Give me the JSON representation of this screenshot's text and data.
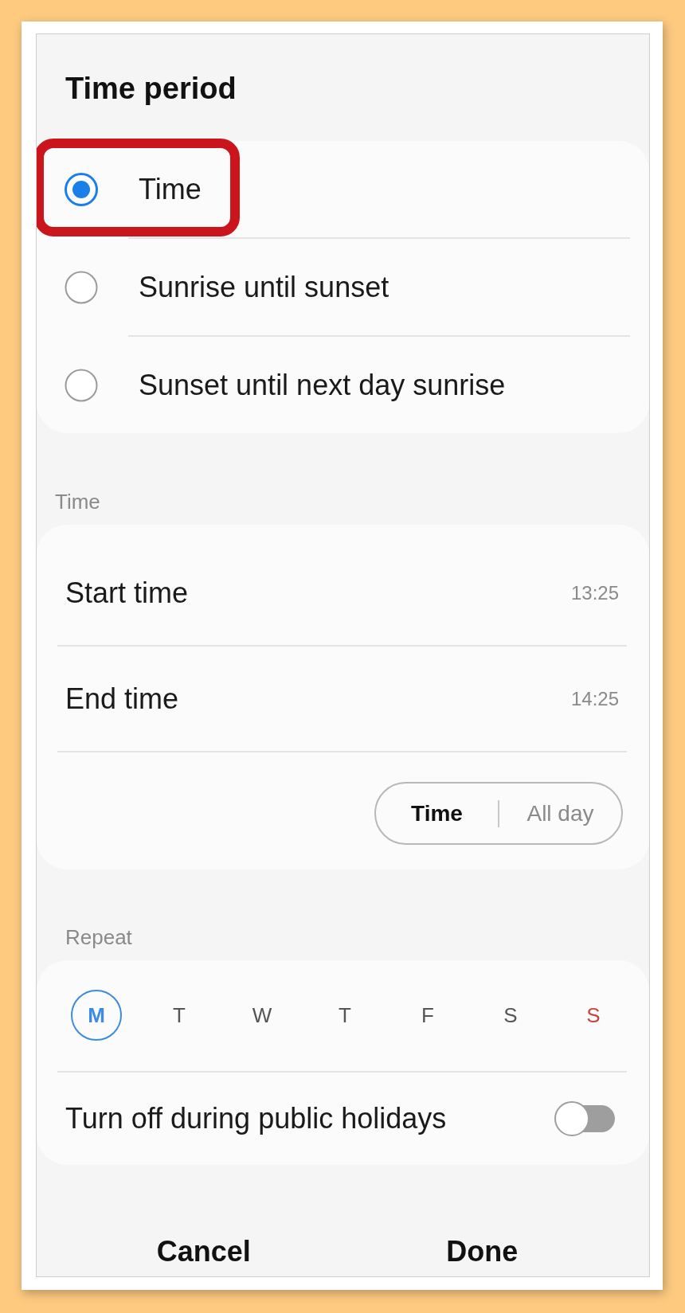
{
  "title": "Time period",
  "time_period": {
    "options": [
      {
        "label": "Time",
        "selected": true,
        "highlighted": true
      },
      {
        "label": "Sunrise until sunset",
        "selected": false,
        "highlighted": false
      },
      {
        "label": "Sunset until next day sunrise",
        "selected": false,
        "highlighted": false
      }
    ]
  },
  "time": {
    "label": "Time",
    "rows": [
      {
        "label": "Start time",
        "value": "13:25"
      },
      {
        "label": "End time",
        "value": "14:25"
      }
    ],
    "modes": [
      {
        "label": "Time",
        "selected": true
      },
      {
        "label": "All day",
        "selected": false
      }
    ]
  },
  "repeat": {
    "label": "Repeat",
    "days": [
      {
        "label": "M",
        "selected": true,
        "color": "#3d8be0"
      },
      {
        "label": "T",
        "selected": false,
        "color": "#555555"
      },
      {
        "label": "W",
        "selected": false,
        "color": "#555555"
      },
      {
        "label": "T",
        "selected": false,
        "color": "#555555"
      },
      {
        "label": "F",
        "selected": false,
        "color": "#555555"
      },
      {
        "label": "S",
        "selected": false,
        "color": "#555555"
      },
      {
        "label": "S",
        "selected": false,
        "color": "#c8453f"
      }
    ],
    "holidays": {
      "label": "Turn off during public holidays",
      "on": false
    }
  },
  "footer": {
    "cancel": "Cancel",
    "done": "Done"
  }
}
